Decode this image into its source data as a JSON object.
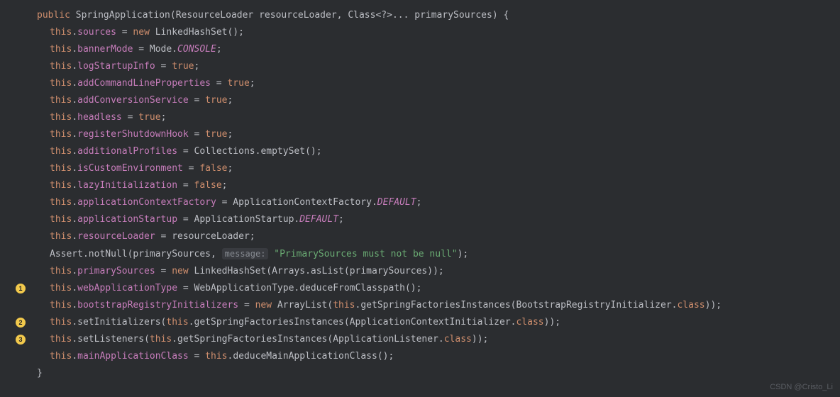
{
  "kw": {
    "public": "public",
    "new": "new",
    "this": "this",
    "true": "true",
    "false": "false",
    "class": "class"
  },
  "sig": {
    "className": "SpringApplication",
    "param1Type": "ResourceLoader",
    "param1Name": "resourceLoader",
    "param2Type": "Class<?>...",
    "param2Name": "primarySources",
    "open": " {",
    "close": "}"
  },
  "l1": {
    "field": "sources",
    "ctor": "LinkedHashSet"
  },
  "l2": {
    "field": "bannerMode",
    "cls": "Mode",
    "val": "CONSOLE"
  },
  "l3": {
    "field": "logStartupInfo"
  },
  "l4": {
    "field": "addCommandLineProperties"
  },
  "l5": {
    "field": "addConversionService"
  },
  "l6": {
    "field": "headless"
  },
  "l7": {
    "field": "registerShutdownHook"
  },
  "l8": {
    "field": "additionalProfiles",
    "cls": "Collections",
    "m": "emptySet"
  },
  "l9": {
    "field": "isCustomEnvironment"
  },
  "l10": {
    "field": "lazyInitialization"
  },
  "l11": {
    "field": "applicationContextFactory",
    "cls": "ApplicationContextFactory",
    "val": "DEFAULT"
  },
  "l12": {
    "field": "applicationStartup",
    "cls": "ApplicationStartup",
    "val": "DEFAULT"
  },
  "l13": {
    "field": "resourceLoader",
    "rhs": "resourceLoader"
  },
  "l14": {
    "cls": "Assert",
    "m": "notNull",
    "arg1": "primarySources",
    "hintLabel": "message:",
    "str": "\"PrimarySources must not be null\""
  },
  "l15": {
    "field": "primarySources",
    "ctor": "LinkedHashSet",
    "cls": "Arrays",
    "m": "asList",
    "arg": "primarySources"
  },
  "l16": {
    "marker": "1",
    "field": "webApplicationType",
    "cls": "WebApplicationType",
    "m": "deduceFromClasspath"
  },
  "l17": {
    "field": "bootstrapRegistryInitializers",
    "ctor": "ArrayList",
    "m": "getSpringFactoriesInstances",
    "argCls": "BootstrapRegistryInitializer"
  },
  "l18": {
    "marker": "2",
    "m1": "setInitializers",
    "m2": "getSpringFactoriesInstances",
    "argCls": "ApplicationContextInitializer"
  },
  "l19": {
    "marker": "3",
    "m1": "setListeners",
    "m2": "getSpringFactoriesInstances",
    "argCls": "ApplicationListener"
  },
  "l20": {
    "field": "mainApplicationClass",
    "m": "deduceMainApplicationClass"
  },
  "watermark": "CSDN @Cristo_Li"
}
